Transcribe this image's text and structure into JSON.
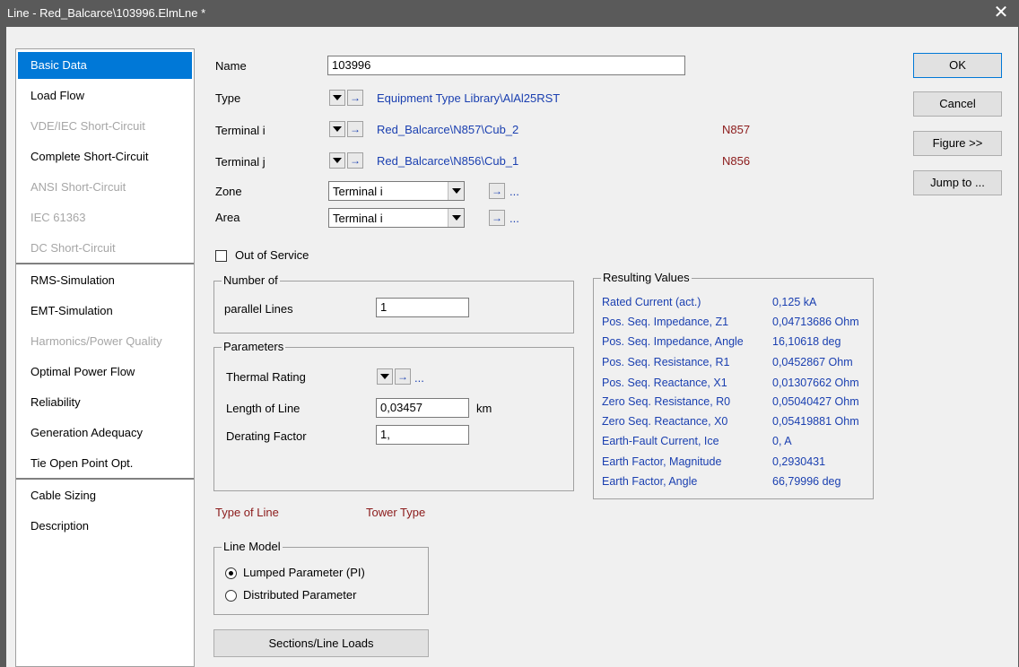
{
  "window": {
    "title": "Line - Red_Balcarce\\103996.ElmLne *",
    "close_glyph": "✕"
  },
  "sidebar": {
    "items": [
      {
        "label": "Basic Data",
        "state": "selected"
      },
      {
        "label": "Load Flow",
        "state": "enabled"
      },
      {
        "label": "VDE/IEC Short-Circuit",
        "state": "disabled"
      },
      {
        "label": "Complete Short-Circuit",
        "state": "enabled"
      },
      {
        "label": "ANSI Short-Circuit",
        "state": "disabled"
      },
      {
        "label": "IEC 61363",
        "state": "disabled"
      },
      {
        "label": "DC Short-Circuit",
        "state": "disabled"
      },
      {
        "label": "RMS-Simulation",
        "state": "enabled"
      },
      {
        "label": "EMT-Simulation",
        "state": "enabled"
      },
      {
        "label": "Harmonics/Power Quality",
        "state": "disabled"
      },
      {
        "label": "Optimal Power Flow",
        "state": "enabled"
      },
      {
        "label": "Reliability",
        "state": "enabled"
      },
      {
        "label": "Generation Adequacy",
        "state": "enabled"
      },
      {
        "label": "Tie Open Point Opt.",
        "state": "enabled"
      },
      {
        "label": "Cable Sizing",
        "state": "enabled"
      },
      {
        "label": "Description",
        "state": "enabled"
      }
    ]
  },
  "form": {
    "name_label": "Name",
    "name_value": "103996",
    "type_label": "Type",
    "type_value": "Equipment Type Library\\AlAl25RST",
    "terminal_i_label": "Terminal i",
    "terminal_i_value": "Red_Balcarce\\N857\\Cub_2",
    "terminal_i_node": "N857",
    "terminal_j_label": "Terminal j",
    "terminal_j_value": "Red_Balcarce\\N856\\Cub_1",
    "terminal_j_node": "N856",
    "zone_label": "Zone",
    "zone_value": "Terminal i",
    "area_label": "Area",
    "area_value": "Terminal i",
    "ellipsis": "...",
    "out_of_service_label": "Out of Service",
    "out_of_service_checked": false
  },
  "number_of": {
    "group_label": "Number of",
    "parallel_label": "parallel Lines",
    "parallel_value": "1"
  },
  "parameters": {
    "group_label": "Parameters",
    "thermal_label": "Thermal Rating",
    "length_label": "Length of Line",
    "length_value": "0,03457",
    "length_unit": "km",
    "derating_label": "Derating Factor",
    "derating_value": "1,"
  },
  "resulting": {
    "group_label": "Resulting Values",
    "rows": [
      {
        "label": "Rated Current (act.)",
        "value": "0,125 kA"
      },
      {
        "label": "Pos. Seq. Impedance, Z1",
        "value": "0,04713686 Ohm"
      },
      {
        "label": "Pos. Seq. Impedance, Angle",
        "value": "16,10618 deg"
      },
      {
        "label": "Pos. Seq. Resistance, R1",
        "value": "0,0452867 Ohm"
      },
      {
        "label": "Pos. Seq. Reactance, X1",
        "value": "0,01307662 Ohm"
      },
      {
        "label": "Zero Seq. Resistance, R0",
        "value": "0,05040427 Ohm"
      },
      {
        "label": "Zero Seq. Reactance, X0",
        "value": "0,05419881 Ohm"
      },
      {
        "label": "Earth-Fault Current, Ice",
        "value": "0, A"
      },
      {
        "label": "Earth Factor, Magnitude",
        "value": "0,2930431"
      },
      {
        "label": "Earth Factor, Angle",
        "value": "66,79996 deg"
      }
    ]
  },
  "type_of_line_label": "Type of Line",
  "tower_type_label": "Tower Type",
  "line_model": {
    "group_label": "Line Model",
    "options": [
      {
        "label": "Lumped Parameter (PI)",
        "selected": true
      },
      {
        "label": "Distributed Parameter",
        "selected": false
      }
    ]
  },
  "sections_button": "Sections/Line Loads",
  "buttons": {
    "ok": "OK",
    "cancel": "Cancel",
    "figure": "Figure >>",
    "jump": "Jump to ..."
  },
  "icons": {
    "arrow": "→"
  }
}
